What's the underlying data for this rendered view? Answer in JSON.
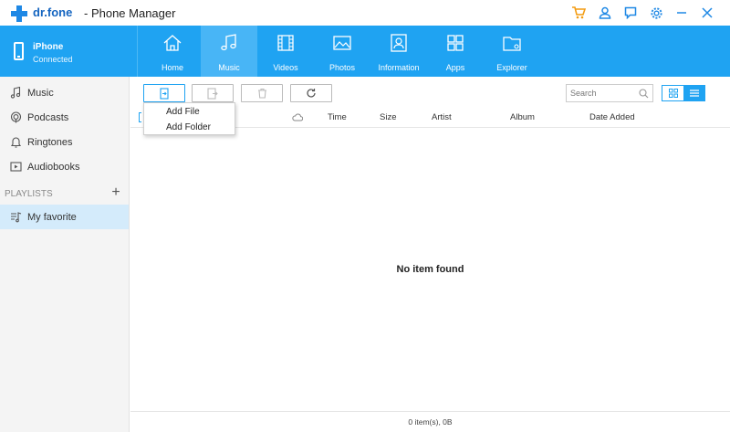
{
  "titlebar": {
    "brand": "dr.fone",
    "app_name": "- Phone Manager",
    "controls": [
      "cart-icon",
      "user-icon",
      "feedback-icon",
      "gear-icon",
      "minimize-icon",
      "close-icon"
    ]
  },
  "device": {
    "name": "iPhone",
    "status": "Connected"
  },
  "nav": {
    "tabs": [
      {
        "label": "Home",
        "icon": "home-icon"
      },
      {
        "label": "Music",
        "icon": "music-icon",
        "active": true
      },
      {
        "label": "Videos",
        "icon": "film-icon"
      },
      {
        "label": "Photos",
        "icon": "image-icon"
      },
      {
        "label": "Information",
        "icon": "contact-card-icon"
      },
      {
        "label": "Apps",
        "icon": "apps-grid-icon"
      },
      {
        "label": "Explorer",
        "icon": "folder-icon"
      }
    ]
  },
  "sidebar": {
    "items": [
      {
        "label": "Music",
        "icon": "music-note-icon"
      },
      {
        "label": "Podcasts",
        "icon": "podcast-icon"
      },
      {
        "label": "Ringtones",
        "icon": "bell-icon"
      },
      {
        "label": "Audiobooks",
        "icon": "audiobook-icon"
      }
    ],
    "playlists_header": "PLAYLISTS",
    "add_symbol": "+",
    "playlists": [
      {
        "label": "My favorite",
        "icon": "playlist-icon",
        "selected": true
      }
    ]
  },
  "toolbar": {
    "search_placeholder": "Search"
  },
  "dropdown": {
    "items": [
      "Add File",
      "Add Folder"
    ]
  },
  "table": {
    "columns": [
      "Time",
      "Size",
      "Artist",
      "Album",
      "Date Added"
    ]
  },
  "empty_message": "No item found",
  "footer": {
    "status": "0 item(s), 0B"
  },
  "colors": {
    "accent": "#1fa3f2",
    "active_tab": "#48b5f6",
    "selected_row": "#d4ebfb",
    "brand": "#1565c0",
    "cart": "#f39c12"
  }
}
